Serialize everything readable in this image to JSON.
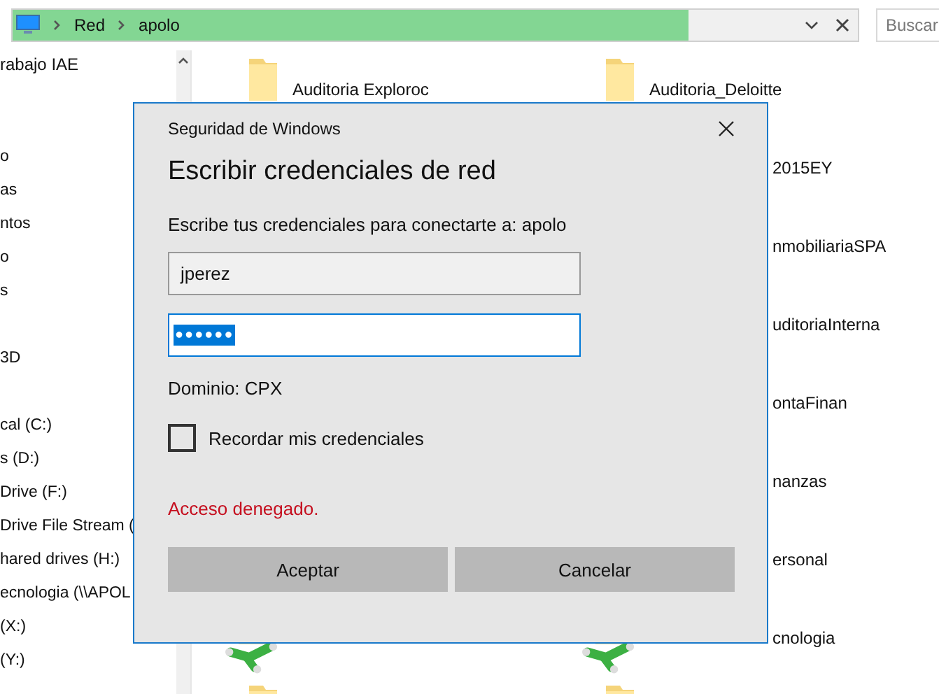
{
  "address_bar": {
    "path": [
      "Red",
      "apolo"
    ],
    "level": 0.8
  },
  "search": {
    "placeholder": "Buscar"
  },
  "nav": {
    "top_item": "rabajo IAE",
    "items": [
      {
        "label": "o",
        "gap_before": false
      },
      {
        "label": "as",
        "gap_before": false
      },
      {
        "label": "ntos",
        "gap_before": false
      },
      {
        "label": "o",
        "gap_before": false
      },
      {
        "label": "s",
        "gap_before": false
      },
      {
        "label": "3D",
        "gap_before": true
      },
      {
        "label": "cal (C:)",
        "gap_before": true
      },
      {
        "label": "s (D:)",
        "gap_before": false
      },
      {
        "label": "Drive (F:)",
        "gap_before": false
      },
      {
        "label": "Drive File Stream (",
        "gap_before": false
      },
      {
        "label": "hared drives (H:)",
        "gap_before": false
      },
      {
        "label": "ecnologia (\\\\APOL",
        "gap_before": false
      },
      {
        "label": "(X:)",
        "gap_before": false
      },
      {
        "label": "(Y:)",
        "gap_before": false
      }
    ]
  },
  "content": {
    "rows": [
      {
        "left": {
          "kind": "folder",
          "name": "Auditoria Exploroc"
        },
        "right": {
          "kind": "folder",
          "name": "Auditoria_Deloitte"
        }
      },
      {
        "right": {
          "name": "2015EY"
        }
      },
      {
        "right": {
          "name": "nmobiliariaSPA"
        }
      },
      {
        "right": {
          "name": "uditoriaInterna"
        }
      },
      {
        "right": {
          "name": "ontaFinan"
        }
      },
      {
        "right": {
          "name": "nanzas"
        }
      },
      {
        "right": {
          "name": "ersonal"
        }
      },
      {
        "left": {
          "kind": "network"
        },
        "right": {
          "kind": "network",
          "name": "cnologia"
        }
      },
      {
        "left": {
          "kind": "folder"
        },
        "right": {
          "kind": "folder"
        }
      }
    ]
  },
  "dialog": {
    "caption": "Seguridad de Windows",
    "title": "Escribir credenciales de red",
    "prompt": "Escribe tus credenciales para conectarte a: apolo",
    "username": "jperez",
    "password": "●●●●●●",
    "domain": "Dominio: CPX",
    "remember": {
      "label": "Recordar mis credenciales",
      "checked": false
    },
    "error": "Acceso denegado.",
    "buttons": [
      "Aceptar",
      "Cancelar"
    ]
  }
}
